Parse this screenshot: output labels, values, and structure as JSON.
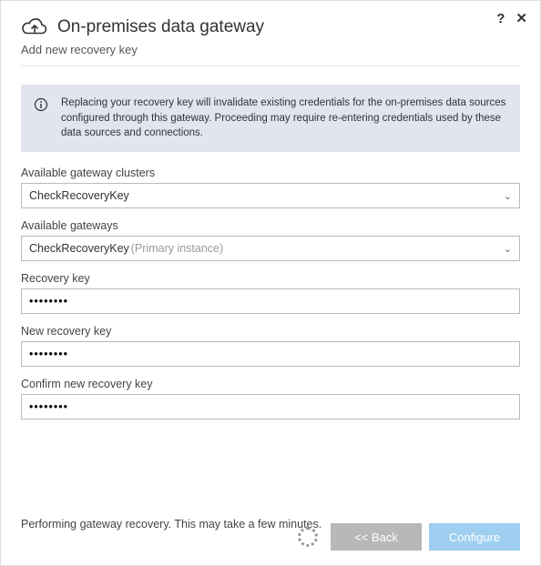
{
  "titlebar": {
    "help_label": "?",
    "close_label": "✕"
  },
  "header": {
    "title": "On-premises data gateway",
    "subtitle": "Add new recovery key"
  },
  "banner": {
    "text": "Replacing your recovery key will invalidate existing credentials for the on-premises data sources configured through this gateway. Proceeding may require re-entering credentials used by these data sources and connections."
  },
  "fields": {
    "clusters": {
      "label": "Available gateway clusters",
      "value": "CheckRecoveryKey"
    },
    "gateways": {
      "label": "Available gateways",
      "value": "CheckRecoveryKey",
      "suffix": "(Primary instance)"
    },
    "recovery_key": {
      "label": "Recovery key",
      "value": "••••••••"
    },
    "new_recovery_key": {
      "label": "New recovery key",
      "value": "••••••••"
    },
    "confirm_recovery_key": {
      "label": "Confirm new recovery key",
      "value": "••••••••"
    }
  },
  "footer": {
    "status": "Performing gateway recovery. This may take a few minutes.",
    "back_label": "<< Back",
    "configure_label": "Configure"
  }
}
